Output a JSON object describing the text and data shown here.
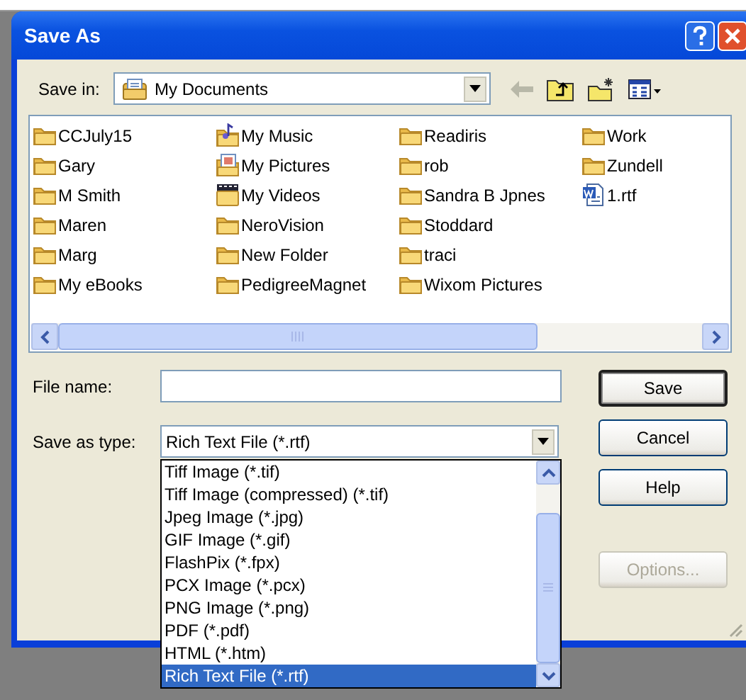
{
  "window": {
    "title": "Save As"
  },
  "save_in": {
    "label": "Save in:",
    "value": "My Documents"
  },
  "files": [
    {
      "name": "CCJuly15",
      "kind": "folder"
    },
    {
      "name": "Gary",
      "kind": "folder"
    },
    {
      "name": "M Smith",
      "kind": "folder"
    },
    {
      "name": "Maren",
      "kind": "folder"
    },
    {
      "name": "Marg",
      "kind": "folder"
    },
    {
      "name": "My eBooks",
      "kind": "folder"
    },
    {
      "name": "My Music",
      "kind": "music"
    },
    {
      "name": "My Pictures",
      "kind": "pictures"
    },
    {
      "name": "My Videos",
      "kind": "videos"
    },
    {
      "name": "NeroVision",
      "kind": "folder"
    },
    {
      "name": "New Folder",
      "kind": "folder"
    },
    {
      "name": "PedigreeMagnet",
      "kind": "folder"
    },
    {
      "name": "Readiris",
      "kind": "folder"
    },
    {
      "name": "rob",
      "kind": "folder"
    },
    {
      "name": "Sandra B Jpnes",
      "kind": "folder"
    },
    {
      "name": "Stoddard",
      "kind": "folder"
    },
    {
      "name": "traci",
      "kind": "folder"
    },
    {
      "name": "Wixom Pictures",
      "kind": "folder"
    },
    {
      "name": "Work",
      "kind": "folder"
    },
    {
      "name": "Zundell",
      "kind": "folder"
    },
    {
      "name": "1.rtf",
      "kind": "document"
    }
  ],
  "file_name": {
    "label": "File name:"
  },
  "save_as_type": {
    "label": "Save as type:",
    "value": "Rich Text File (*.rtf)",
    "expanded": true,
    "options": [
      {
        "label": "Tiff Image (*.tif)",
        "selected": false
      },
      {
        "label": "Tiff Image (compressed) (*.tif)",
        "selected": false
      },
      {
        "label": "Jpeg Image (*.jpg)",
        "selected": false
      },
      {
        "label": "GIF Image (*.gif)",
        "selected": false
      },
      {
        "label": "FlashPix (*.fpx)",
        "selected": false
      },
      {
        "label": "PCX Image (*.pcx)",
        "selected": false
      },
      {
        "label": "PNG Image (*.png)",
        "selected": false
      },
      {
        "label": "PDF (*.pdf)",
        "selected": false
      },
      {
        "label": "HTML (*.htm)",
        "selected": false
      },
      {
        "label": "Rich Text File (*.rtf)",
        "selected": true
      }
    ]
  },
  "buttons": [
    {
      "label": "Save",
      "default": true,
      "disabled": false
    },
    {
      "label": "Cancel",
      "default": false,
      "disabled": false
    },
    {
      "label": "Help",
      "default": false,
      "disabled": false
    },
    {
      "label": "Options...",
      "default": false,
      "disabled": true
    }
  ]
}
